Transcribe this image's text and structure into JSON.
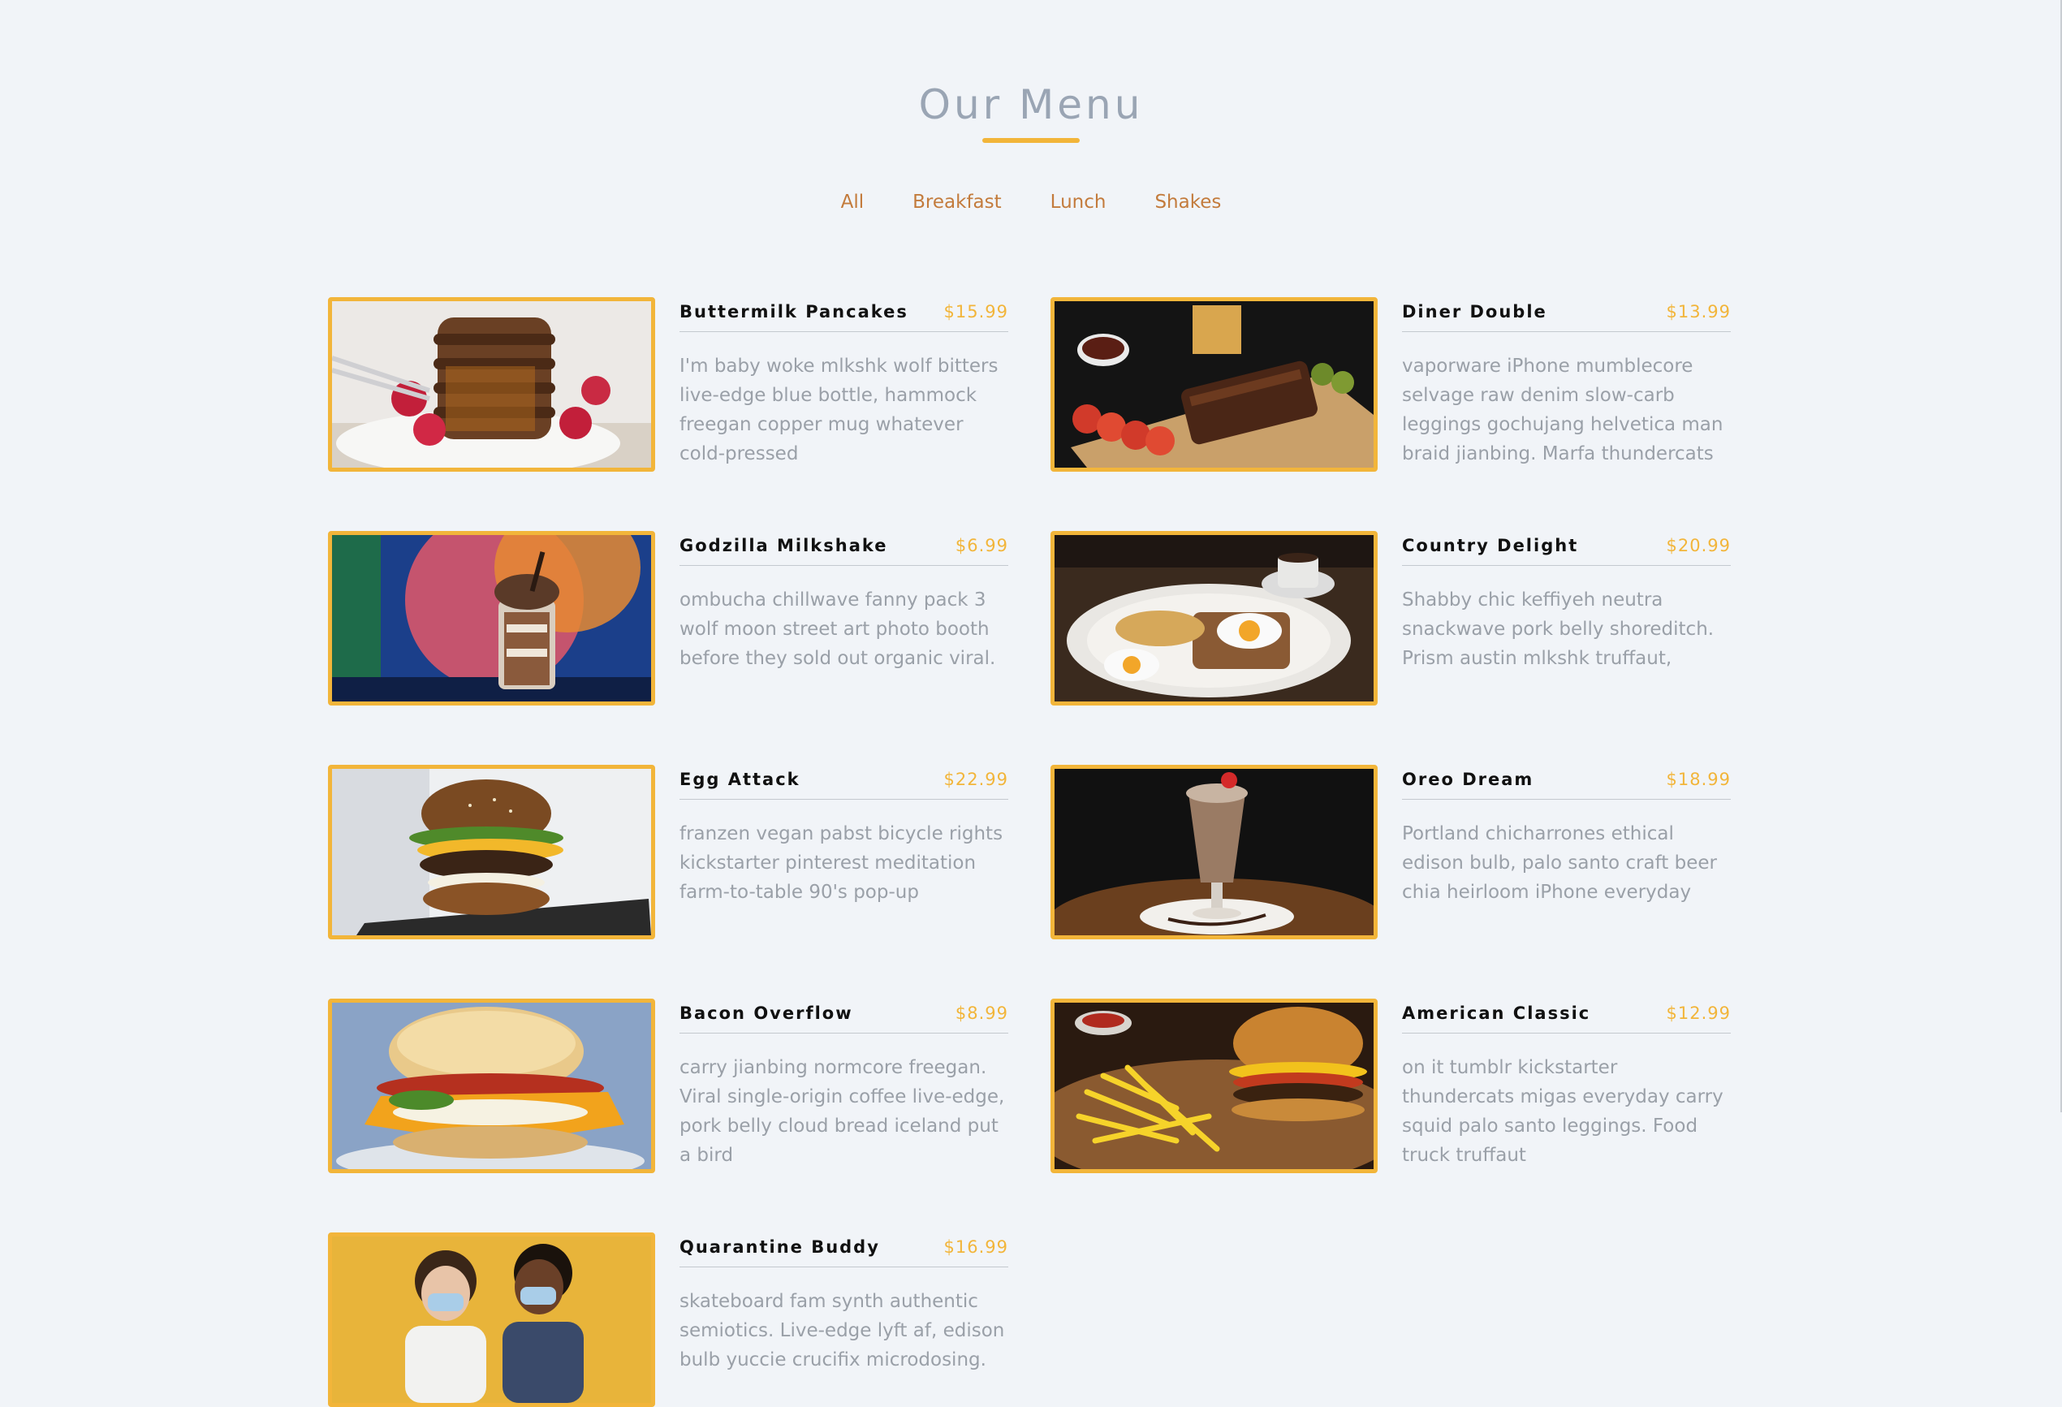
{
  "header": {
    "title": "Our Menu"
  },
  "filters": [
    "All",
    "Breakfast",
    "Lunch",
    "Shakes"
  ],
  "colors": {
    "background": "#f1f4f8",
    "accent": "#f2b53a",
    "filter_text": "#c37b3c",
    "title_text": "#9aa5b4",
    "description_text": "#9aa0a8"
  },
  "items": [
    {
      "name": "Buttermilk Pancakes",
      "price": "$15.99",
      "description": "I'm baby woke mlkshk wolf bitters live-edge blue bottle, hammock freegan copper mug whatever cold-pressed",
      "photo": "pancakes-photo"
    },
    {
      "name": "Diner Double",
      "price": "$13.99",
      "description": "vaporware iPhone mumblecore selvage raw denim slow-carb leggings gochujang helvetica man braid jianbing. Marfa thundercats",
      "photo": "ribs-platter-photo"
    },
    {
      "name": "Godzilla Milkshake",
      "price": "$6.99",
      "description": "ombucha chillwave fanny pack 3 wolf moon street art photo booth before they sold out organic viral.",
      "photo": "milkshake-jar-photo"
    },
    {
      "name": "Country Delight",
      "price": "$20.99",
      "description": "Shabby chic keffiyeh neutra snackwave pork belly shoreditch. Prism austin mlkshk truffaut,",
      "photo": "eggs-toast-photo"
    },
    {
      "name": "Egg Attack",
      "price": "$22.99",
      "description": "franzen vegan pabst bicycle rights kickstarter pinterest meditation farm-to-table 90's pop-up",
      "photo": "egg-burger-photo"
    },
    {
      "name": "Oreo Dream",
      "price": "$18.99",
      "description": "Portland chicharrones ethical edison bulb, palo santo craft beer chia heirloom iPhone everyday",
      "photo": "oreo-shake-photo"
    },
    {
      "name": "Bacon Overflow",
      "price": "$8.99",
      "description": "carry jianbing normcore freegan. Viral single-origin coffee live-edge, pork belly cloud bread iceland put a bird",
      "photo": "bacon-biscuit-photo"
    },
    {
      "name": "American Classic",
      "price": "$12.99",
      "description": "on it tumblr kickstarter thundercats migas everyday carry squid palo santo leggings. Food truck truffaut",
      "photo": "burger-fries-photo"
    },
    {
      "name": "Quarantine Buddy",
      "price": "$16.99",
      "description": "skateboard fam synth authentic semiotics. Live-edge lyft af, edison bulb yuccie crucifix microdosing.",
      "photo": "masked-couple-photo"
    }
  ]
}
